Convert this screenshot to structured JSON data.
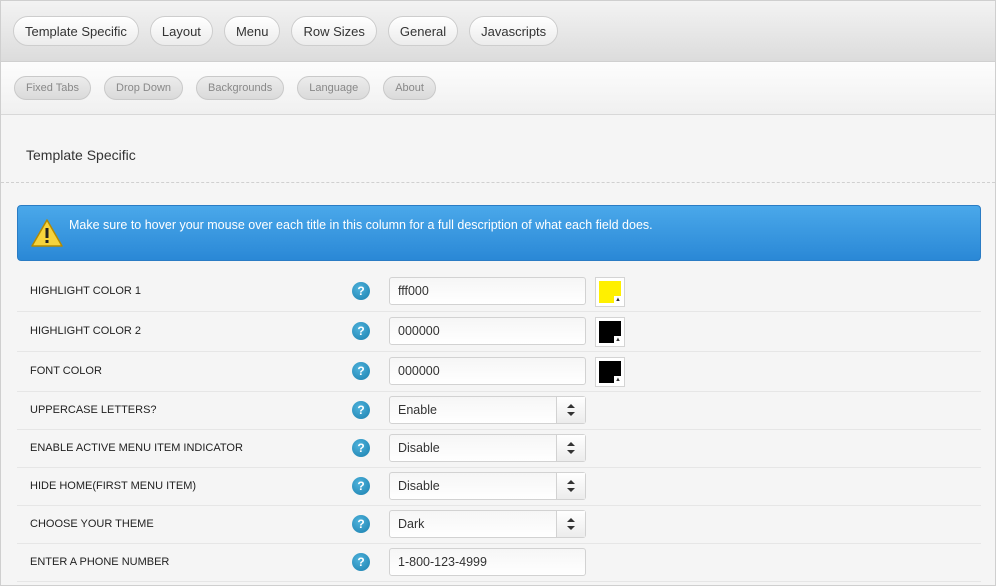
{
  "tabs": [
    "Template Specific",
    "Layout",
    "Menu",
    "Row Sizes",
    "General",
    "Javascripts"
  ],
  "subtabs": [
    "Fixed Tabs",
    "Drop Down",
    "Backgrounds",
    "Language",
    "About"
  ],
  "section_title": "Template Specific",
  "notice": {
    "icon": "warning-icon",
    "text": "Make sure to hover your mouse over each title in this column for a full description of what each field does."
  },
  "rows": [
    {
      "label": "HIGHLIGHT COLOR 1",
      "value": "fff000",
      "type": "color",
      "swatch": "#fff000"
    },
    {
      "label": "HIGHLIGHT COLOR 2",
      "value": "000000",
      "type": "color",
      "swatch": "#000000"
    },
    {
      "label": "FONT COLOR",
      "value": "000000",
      "type": "color",
      "swatch": "#000000"
    },
    {
      "label": "UPPERCASE LETTERS?",
      "value": "Enable",
      "type": "select"
    },
    {
      "label": "ENABLE ACTIVE MENU ITEM INDICATOR",
      "value": "Disable",
      "type": "select"
    },
    {
      "label": "HIDE HOME(FIRST MENU ITEM)",
      "value": "Disable",
      "type": "select"
    },
    {
      "label": "CHOOSE YOUR THEME",
      "value": "Dark",
      "type": "select"
    },
    {
      "label": "ENTER A PHONE NUMBER",
      "value": "1-800-123-4999",
      "type": "text"
    }
  ],
  "help_glyph": "?"
}
